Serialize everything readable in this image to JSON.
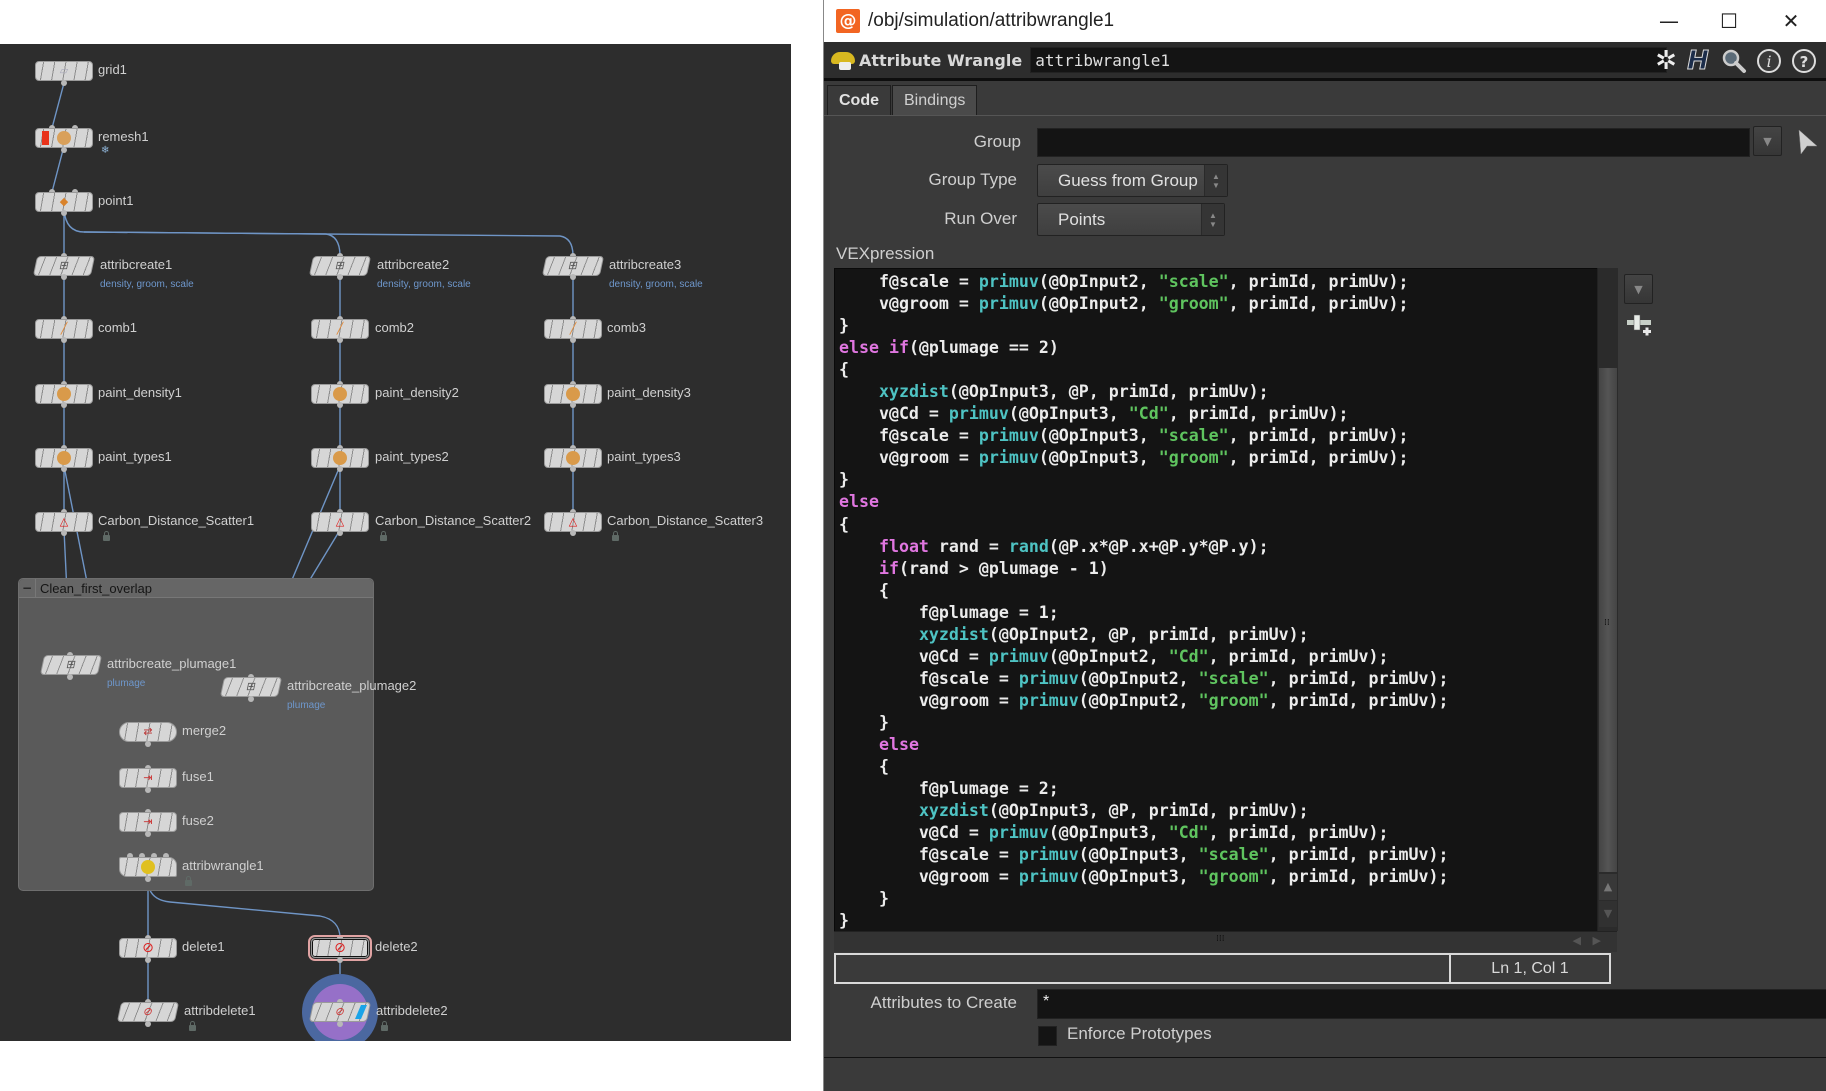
{
  "network": {
    "nodes": [
      {
        "id": "grid1",
        "label": "grid1"
      },
      {
        "id": "remesh1",
        "label": "remesh1"
      },
      {
        "id": "point1",
        "label": "point1"
      },
      {
        "id": "attribcreate1",
        "label": "attribcreate1",
        "sub": "density, groom, scale"
      },
      {
        "id": "attribcreate2",
        "label": "attribcreate2",
        "sub": "density, groom, scale"
      },
      {
        "id": "attribcreate3",
        "label": "attribcreate3",
        "sub": "density, groom, scale"
      },
      {
        "id": "comb1",
        "label": "comb1"
      },
      {
        "id": "comb2",
        "label": "comb2"
      },
      {
        "id": "comb3",
        "label": "comb3"
      },
      {
        "id": "paint_density1",
        "label": "paint_density1"
      },
      {
        "id": "paint_density2",
        "label": "paint_density2"
      },
      {
        "id": "paint_density3",
        "label": "paint_density3"
      },
      {
        "id": "paint_types1",
        "label": "paint_types1"
      },
      {
        "id": "paint_types2",
        "label": "paint_types2"
      },
      {
        "id": "paint_types3",
        "label": "paint_types3"
      },
      {
        "id": "Carbon_Distance_Scatter1",
        "label": "Carbon_Distance_Scatter1"
      },
      {
        "id": "Carbon_Distance_Scatter2",
        "label": "Carbon_Distance_Scatter2"
      },
      {
        "id": "Carbon_Distance_Scatter3",
        "label": "Carbon_Distance_Scatter3"
      },
      {
        "id": "attribcreate_plumage1",
        "label": "attribcreate_plumage1",
        "sub": "plumage"
      },
      {
        "id": "attribcreate_plumage2",
        "label": "attribcreate_plumage2",
        "sub": "plumage"
      },
      {
        "id": "merge2",
        "label": "merge2"
      },
      {
        "id": "fuse1",
        "label": "fuse1"
      },
      {
        "id": "fuse2",
        "label": "fuse2"
      },
      {
        "id": "attribwrangle1",
        "label": "attribwrangle1"
      },
      {
        "id": "delete1",
        "label": "delete1"
      },
      {
        "id": "delete2",
        "label": "delete2"
      },
      {
        "id": "attribdelete1",
        "label": "attribdelete1"
      },
      {
        "id": "attribdelete2",
        "label": "attribdelete2"
      }
    ],
    "network_box": {
      "label": "Clean_first_overlap"
    }
  },
  "window": {
    "title": "/obj/simulation/attribwrangle1",
    "controls": {
      "minimize": "—",
      "maximize": "☐",
      "close": "✕"
    }
  },
  "operator": {
    "type_label": "Attribute Wrangle",
    "name": "attribwrangle1",
    "toolbar_icons": [
      "gear-icon",
      "houdini-h-icon",
      "search-icon",
      "info-icon",
      "help-icon"
    ]
  },
  "tabs": [
    {
      "label": "Code",
      "active": true
    },
    {
      "label": "Bindings",
      "active": false
    }
  ],
  "params": {
    "group": {
      "label": "Group",
      "value": ""
    },
    "group_type": {
      "label": "Group Type",
      "value": "Guess from Group"
    },
    "run_over": {
      "label": "Run Over",
      "value": "Points"
    },
    "vexpression_label": "VEXpression",
    "status_position": "Ln 1, Col 1",
    "attributes_to_create": {
      "label": "Attributes to Create",
      "value": "*"
    },
    "enforce_prototypes": {
      "label": "Enforce Prototypes",
      "checked": false
    }
  },
  "code_lines": [
    "    f@scale = primuv(@OpInput2, \"scale\", primId, primUv);",
    "    v@groom = primuv(@OpInput2, \"groom\", primId, primUv);",
    "}",
    "else if(@plumage == 2)",
    "{",
    "    xyzdist(@OpInput3, @P, primId, primUv);",
    "    v@Cd = primuv(@OpInput3, \"Cd\", primId, primUv);",
    "    f@scale = primuv(@OpInput3, \"scale\", primId, primUv);",
    "    v@groom = primuv(@OpInput3, \"groom\", primId, primUv);",
    "}",
    "else",
    "{",
    "    float rand = rand(@P.x*@P.x+@P.y*@P.y);",
    "    if(rand > @plumage - 1)",
    "    {",
    "        f@plumage = 1;",
    "        xyzdist(@OpInput2, @P, primId, primUv);",
    "        v@Cd = primuv(@OpInput2, \"Cd\", primId, primUv);",
    "        f@scale = primuv(@OpInput2, \"scale\", primId, primUv);",
    "        v@groom = primuv(@OpInput2, \"groom\", primId, primUv);",
    "    }",
    "    else",
    "    {",
    "        f@plumage = 2;",
    "        xyzdist(@OpInput3, @P, primId, primUv);",
    "        v@Cd = primuv(@OpInput3, \"Cd\", primId, primUv);",
    "        f@scale = primuv(@OpInput3, \"scale\", primId, primUv);",
    "        v@groom = primuv(@OpInput3, \"groom\", primId, primUv);",
    "    }",
    "}"
  ],
  "colors": {
    "keyword": "#e076e0",
    "function": "#4ec3c3",
    "string": "#5fc45f",
    "wire": "#6f95c6",
    "network_bg": "#2d2d2d",
    "houdini_orange": "#f26522"
  }
}
